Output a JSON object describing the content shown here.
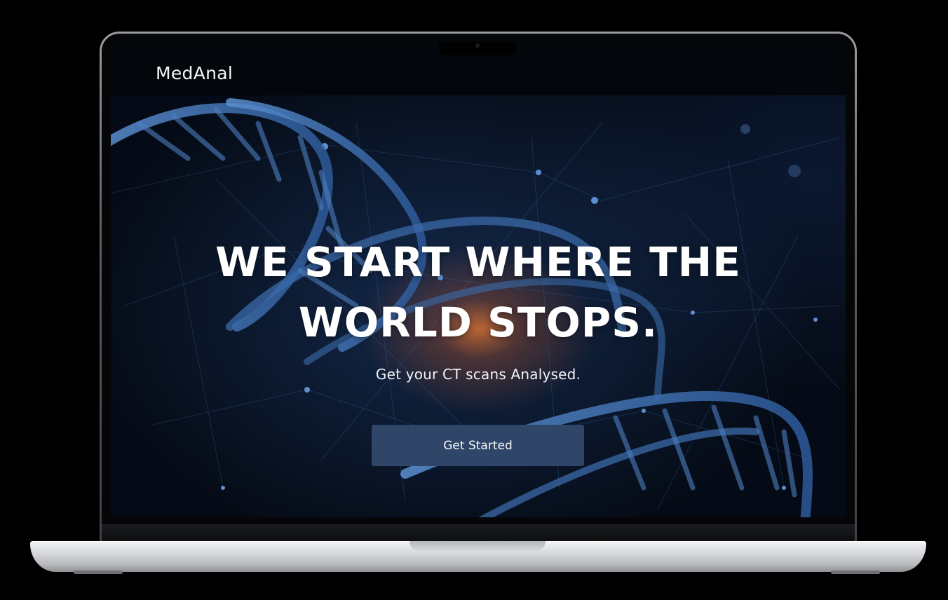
{
  "site": {
    "logo_text": "MedAnal"
  },
  "hero": {
    "headline_line1": "WE START WHERE THE",
    "headline_line2": "WORLD STOPS.",
    "subheadline": "Get your CT scans Analysed.",
    "cta_label": "Get Started",
    "background_image": "dna-helix-network-image"
  },
  "colors": {
    "page_background": "#000000",
    "screen_background": "#03060b",
    "cta_background": "#2f4669",
    "text": "#ffffff",
    "glow": "#d67030"
  }
}
